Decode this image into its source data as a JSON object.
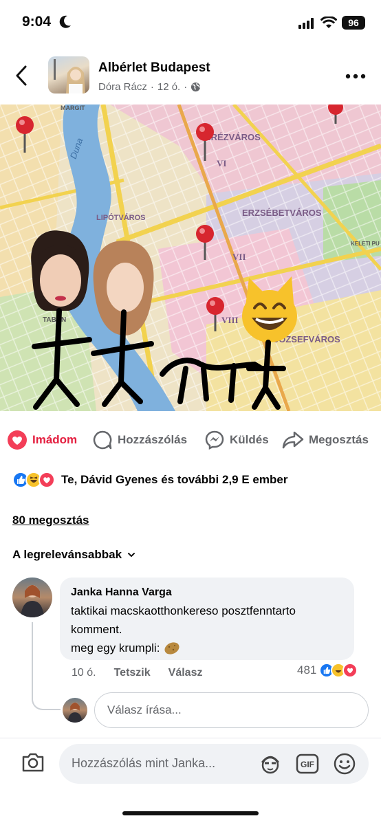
{
  "status": {
    "time": "9:04",
    "battery": "96"
  },
  "post": {
    "group_name": "Albérlet Budapest",
    "author": "Dóra Rácz",
    "time": "12 ó.",
    "separator": "·",
    "map_labels": {
      "terezvaros": "TERÉZVÁROS",
      "vi": "VI",
      "erzsebetvaros": "ERZSÉBETVÁROS",
      "vii": "VII",
      "lipotvaros": "LIPÓTVÁROS",
      "viii": "VIII",
      "jozsefvaros": "JÓZSEFVÁROS",
      "duna": "Duna",
      "tabán": "TABÁN",
      "margit": "MARGIT",
      "keleti": "KELETI PU"
    }
  },
  "actions": {
    "love": "Imádom",
    "comment": "Hozzászólás",
    "send": "Küldés",
    "share": "Megosztás"
  },
  "reactions": {
    "summary": "Te, Dávid Gyenes és további 2,9 E ember",
    "icons": [
      "like-icon",
      "haha-icon",
      "love-icon"
    ]
  },
  "shares": "80 megosztás",
  "sort_label": "A legrelevánsabbak",
  "comment": {
    "author": "Janka Hanna Varga",
    "line1": "taktikai macskaotthonkereso posztfenntarto",
    "line2": "komment.",
    "line3": "meg egy krumpli:",
    "time": "10 ó.",
    "like": "Tetszik",
    "reply": "Válasz",
    "reaction_count": "481"
  },
  "reply_placeholder": "Válasz írása...",
  "composer_placeholder": "Hozzászólás mint Janka...",
  "colors": {
    "love": "#e41e3f",
    "like": "#1877f2",
    "muted": "#65676b"
  }
}
